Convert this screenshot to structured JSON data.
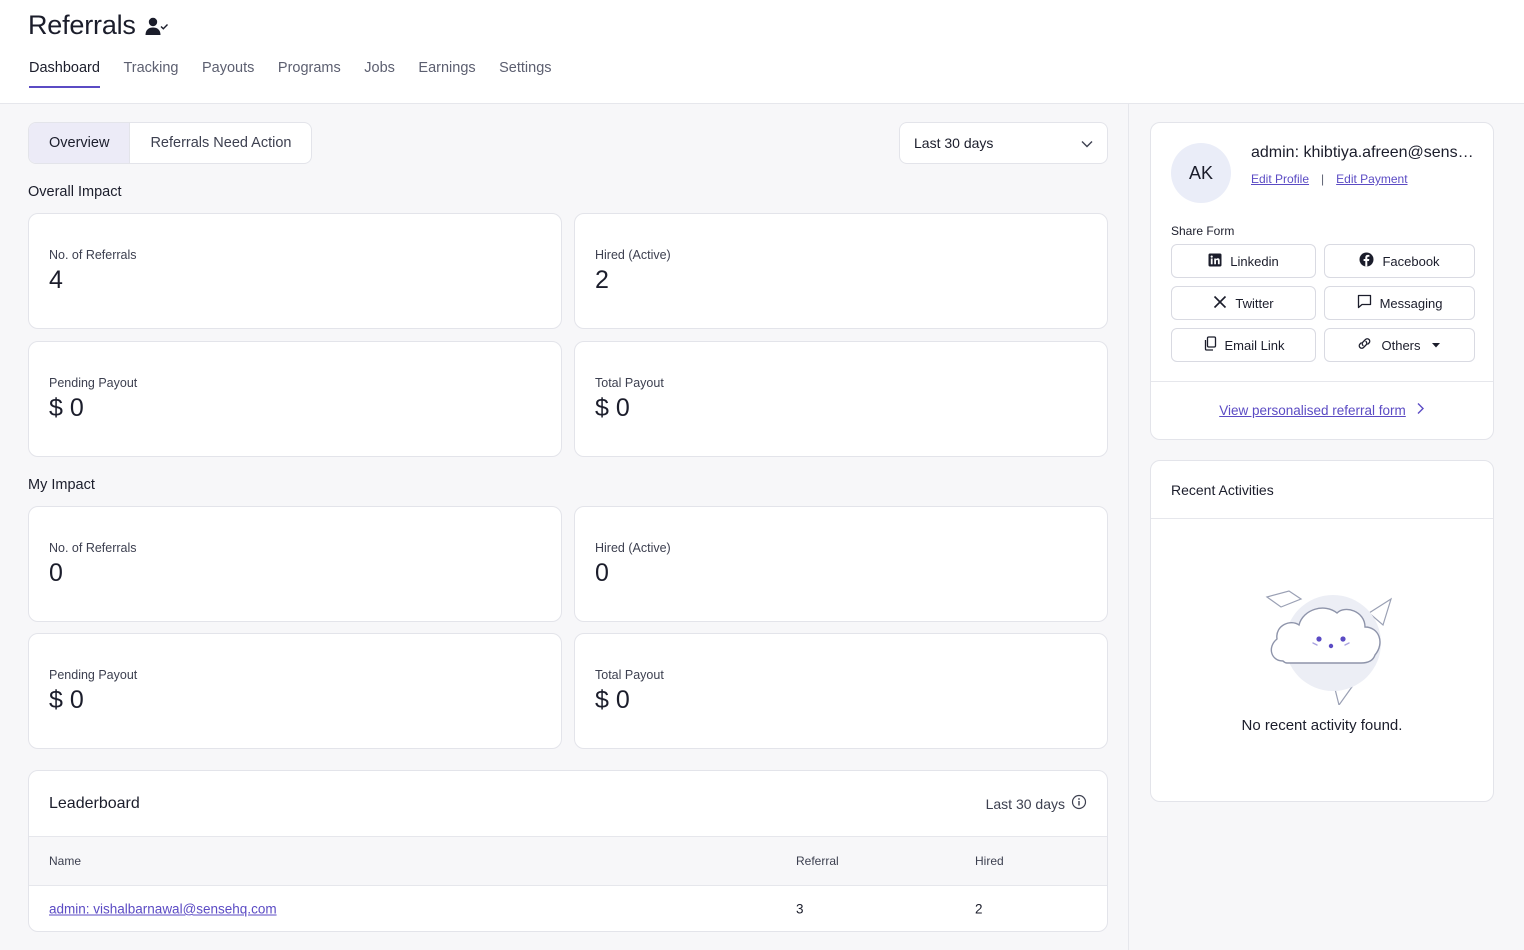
{
  "header": {
    "title": "Referrals",
    "tabs": [
      {
        "label": "Dashboard",
        "active": true
      },
      {
        "label": "Tracking"
      },
      {
        "label": "Payouts"
      },
      {
        "label": "Programs"
      },
      {
        "label": "Jobs"
      },
      {
        "label": "Earnings"
      },
      {
        "label": "Settings"
      }
    ]
  },
  "toolbar": {
    "segments": [
      "Overview",
      "Referrals Need Action"
    ],
    "active_segment": "Overview",
    "range": "Last 30 days"
  },
  "overall": {
    "title": "Overall Impact",
    "referrals_label": "No. of Referrals",
    "referrals_value": "4",
    "hired_label": "Hired (Active)",
    "hired_value": "2",
    "pending_label": "Pending Payout",
    "pending_value": "$ 0",
    "total_label": "Total Payout",
    "total_value": "$ 0"
  },
  "mine": {
    "title": "My Impact",
    "referrals_label": "No. of Referrals",
    "referrals_value": "0",
    "hired_label": "Hired (Active)",
    "hired_value": "0",
    "pending_label": "Pending Payout",
    "pending_value": "$ 0",
    "total_label": "Total Payout",
    "total_value": "$ 0"
  },
  "leaderboard": {
    "title": "Leaderboard",
    "range": "Last 30 days",
    "columns": {
      "name": "Name",
      "referral": "Referral",
      "hired": "Hired"
    },
    "rows": [
      {
        "name": "admin: vishalbarnawal@sensehq.com",
        "referral": "3",
        "hired": "2"
      }
    ]
  },
  "profile": {
    "initials": "AK",
    "name": "admin: khibtiya.afreen@sensehq.com",
    "edit_profile": "Edit Profile",
    "separator": "|",
    "edit_payment": "Edit Payment",
    "share_label": "Share Form",
    "share": {
      "linkedin": "Linkedin",
      "facebook": "Facebook",
      "twitter": "Twitter",
      "messaging": "Messaging",
      "email": "Email Link",
      "others": "Others"
    },
    "view_form": "View personalised referral form"
  },
  "recent": {
    "title": "Recent Activities",
    "empty": "No recent activity found."
  },
  "colors": {
    "accent": "#5b4bc4",
    "page_bg": "#f7f7f9",
    "segment_active": "#ecebf7"
  }
}
